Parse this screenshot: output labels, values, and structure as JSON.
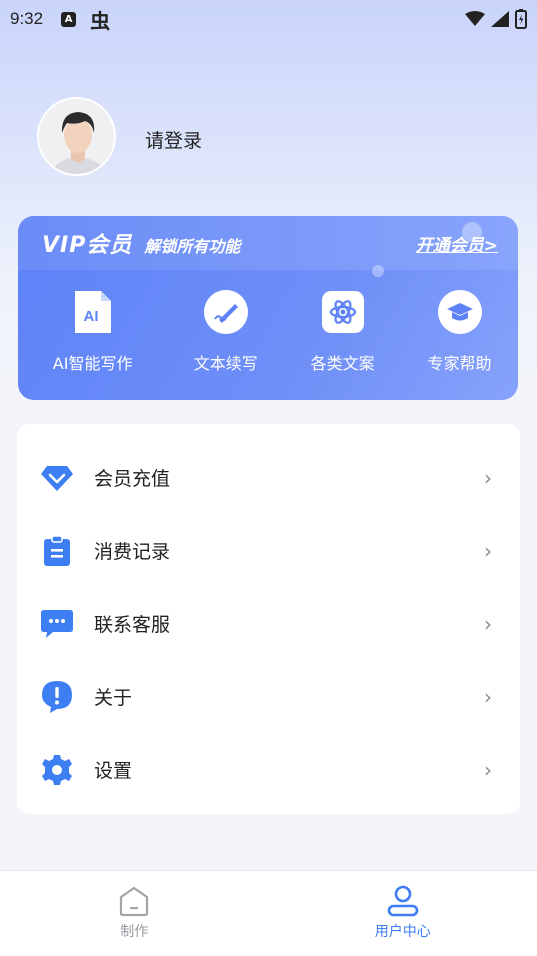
{
  "status_bar": {
    "time": "9:32",
    "a_badge": "A",
    "bug_glyph": "虫",
    "icons": [
      "wifi-icon",
      "signal-icon",
      "battery-icon"
    ]
  },
  "profile": {
    "login_text": "请登录"
  },
  "vip": {
    "title": "VIP会员",
    "subtitle": "解锁所有功能",
    "open_link": "开通会员>",
    "features": [
      {
        "icon": "ai-doc-icon",
        "icon_text": "AI",
        "label": "AI智能写作"
      },
      {
        "icon": "pen-icon",
        "label": "文本续写"
      },
      {
        "icon": "atom-icon",
        "label": "各类文案"
      },
      {
        "icon": "graduation-cap-icon",
        "label": "专家帮助"
      }
    ]
  },
  "menu": {
    "items": [
      {
        "icon": "diamond-icon",
        "label": "会员充值"
      },
      {
        "icon": "clipboard-icon",
        "label": "消费记录"
      },
      {
        "icon": "chat-icon",
        "label": "联系客服"
      },
      {
        "icon": "info-icon",
        "label": "关于"
      },
      {
        "icon": "gear-icon",
        "label": "设置"
      }
    ],
    "chevron": "›"
  },
  "tab_bar": {
    "tabs": [
      {
        "icon": "home-icon",
        "label": "制作",
        "active": false
      },
      {
        "icon": "user-icon",
        "label": "用户中心",
        "active": true
      }
    ]
  },
  "colors": {
    "accent": "#3f7cf3",
    "vip_bg": "#6a8af7",
    "menu_icon": "#3d7ef2"
  }
}
